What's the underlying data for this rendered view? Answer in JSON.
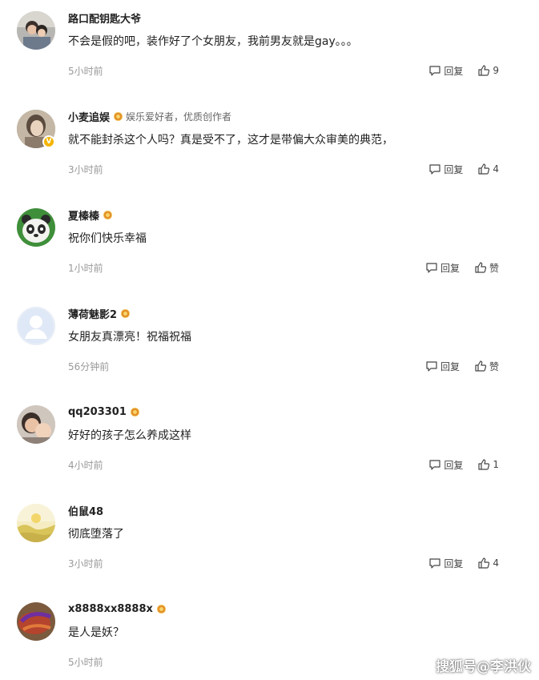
{
  "comments": [
    {
      "name": "路口配钥匙大爷",
      "tag": "",
      "medal": false,
      "verified": false,
      "content": "不会是假的吧，装作好了个女朋友，我前男友就是gay。。。",
      "time": "5小时前",
      "reply_label": "回复",
      "like_label": "9",
      "avatar": "avatar-photo-couple"
    },
    {
      "name": "小麦追娱",
      "tag": "娱乐爱好者，优质创作者",
      "medal": true,
      "verified": true,
      "content": "就不能封杀这个人吗？真是受不了，这才是带偏大众审美的典范，",
      "time": "3小时前",
      "reply_label": "回复",
      "like_label": "4",
      "avatar": "avatar-photo-woman"
    },
    {
      "name": "夏榛榛",
      "tag": "",
      "medal": true,
      "verified": false,
      "content": "祝你们快乐幸福",
      "time": "1小时前",
      "reply_label": "回复",
      "like_label": "赞",
      "avatar": "avatar-panda"
    },
    {
      "name": "薄荷魅影2",
      "tag": "",
      "medal": true,
      "verified": false,
      "content": "女朋友真漂亮！祝福祝福",
      "time": "56分钟前",
      "reply_label": "回复",
      "like_label": "赞",
      "avatar": "avatar-default"
    },
    {
      "name": "qq203301",
      "tag": "",
      "medal": true,
      "verified": false,
      "content": "好好的孩子怎么养成这样",
      "time": "4小时前",
      "reply_label": "回复",
      "like_label": "1",
      "avatar": "avatar-photo-baby"
    },
    {
      "name": "伯鼠48",
      "tag": "",
      "medal": false,
      "verified": false,
      "content": "彻底堕落了",
      "time": "3小时前",
      "reply_label": "回复",
      "like_label": "4",
      "avatar": "avatar-landscape"
    },
    {
      "name": "x8888xx8888x",
      "tag": "",
      "medal": true,
      "verified": false,
      "content": "是人是妖？",
      "time": "5小时前",
      "reply_label": "",
      "like_label": "",
      "avatar": "avatar-food"
    }
  ],
  "watermark": "搜狐号@李洪伙",
  "colors": {
    "name": "#222222",
    "time": "#999999",
    "medal": "#e3922a",
    "verified": "#f4b400"
  }
}
